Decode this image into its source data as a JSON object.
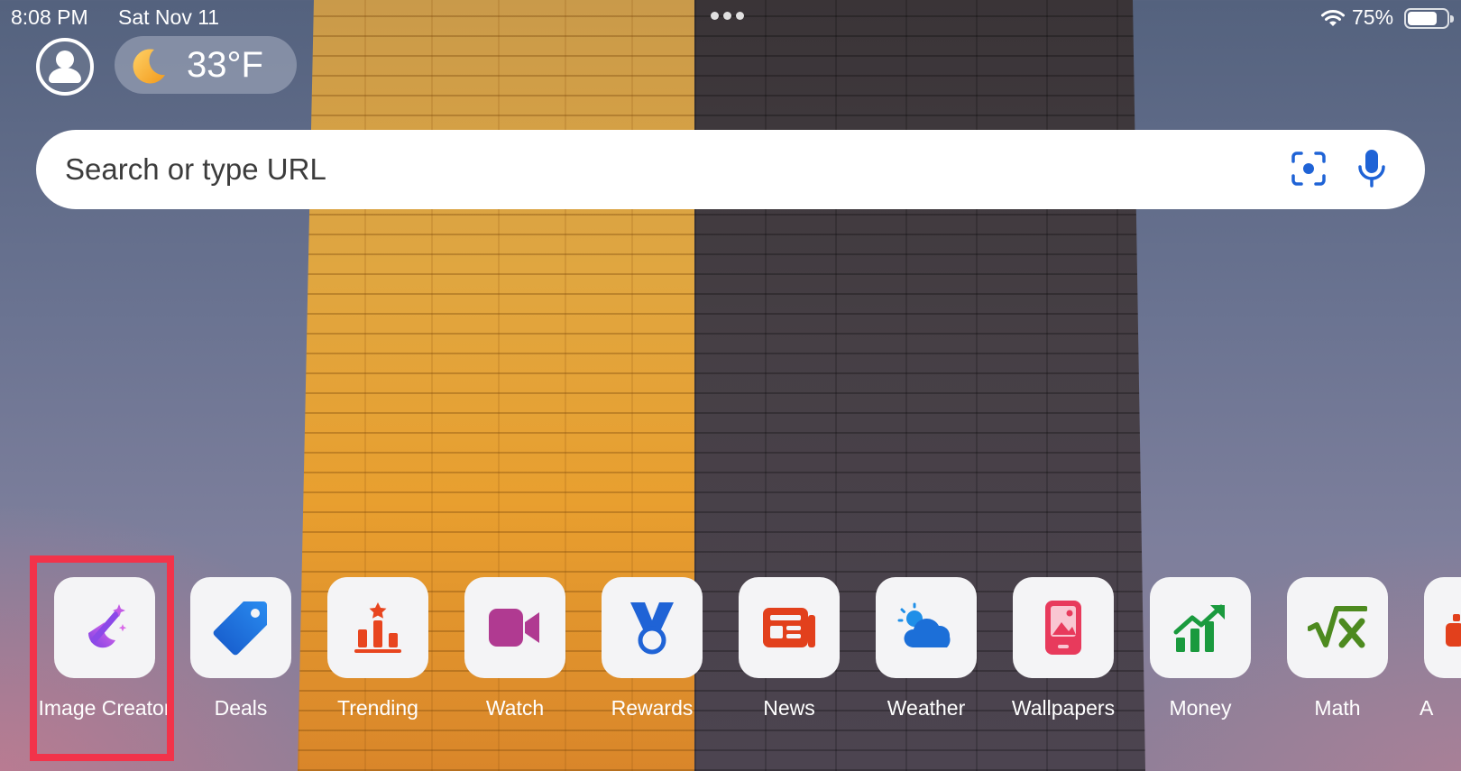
{
  "status_bar": {
    "time": "8:08 PM",
    "date": "Sat Nov 11",
    "battery_percent": "75%",
    "battery_level": 0.75
  },
  "header": {
    "weather_temp": "33°F",
    "weather_icon": "moon-icon",
    "profile_icon": "person-icon"
  },
  "search": {
    "placeholder": "Search or type URL",
    "visual_search_icon": "visual-search-icon",
    "mic_icon": "microphone-icon"
  },
  "apps": [
    {
      "label": "Image Creator",
      "icon": "image-creator-icon",
      "highlighted": true
    },
    {
      "label": "Deals",
      "icon": "price-tag-icon"
    },
    {
      "label": "Trending",
      "icon": "trending-chart-icon"
    },
    {
      "label": "Watch",
      "icon": "video-camera-icon"
    },
    {
      "label": "Rewards",
      "icon": "medal-icon"
    },
    {
      "label": "News",
      "icon": "newspaper-icon"
    },
    {
      "label": "Weather",
      "icon": "cloud-sun-icon"
    },
    {
      "label": "Wallpapers",
      "icon": "phone-picture-icon"
    },
    {
      "label": "Money",
      "icon": "stock-chart-icon"
    },
    {
      "label": "Math",
      "icon": "square-root-icon"
    },
    {
      "label": "A",
      "icon": "partial-app-icon"
    }
  ],
  "colors": {
    "highlight": "#f2334a",
    "accent_blue": "#1f63d6"
  }
}
